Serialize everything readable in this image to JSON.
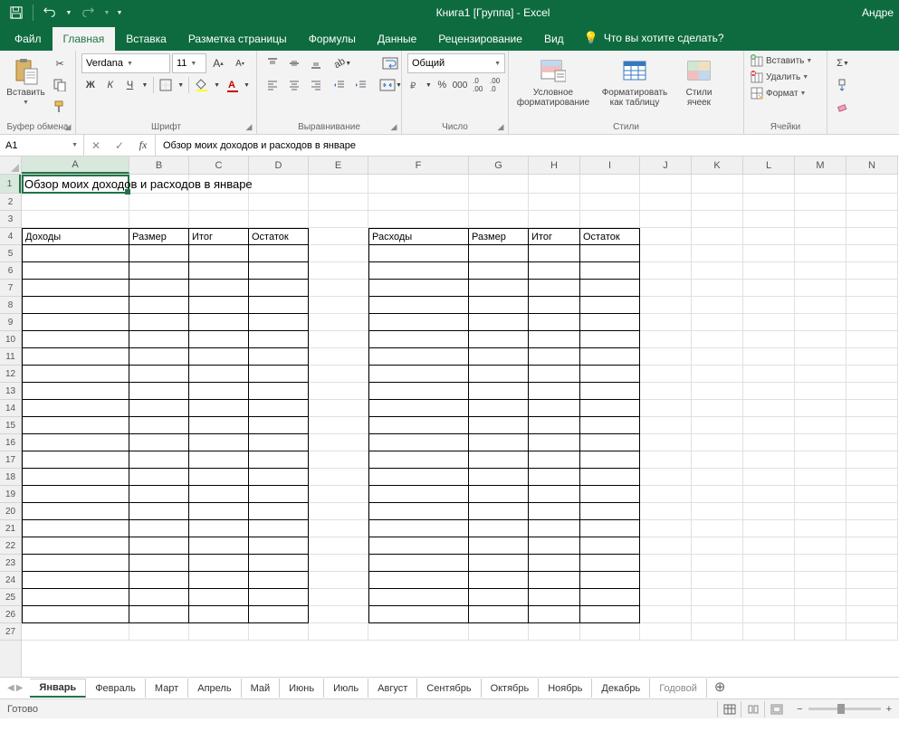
{
  "title": "Книга1  [Группа] - Excel",
  "user": "Андре",
  "menutabs": {
    "file": "Файл",
    "home": "Главная",
    "insert": "Вставка",
    "layout": "Разметка страницы",
    "formulas": "Формулы",
    "data": "Данные",
    "review": "Рецензирование",
    "view": "Вид"
  },
  "tellme": "Что вы хотите сделать?",
  "ribbon": {
    "clipboard": {
      "label": "Буфер обмена",
      "paste": "Вставить"
    },
    "font": {
      "label": "Шрифт",
      "fontname": "Verdana",
      "fontsize": "11"
    },
    "alignment": {
      "label": "Выравнивание"
    },
    "number": {
      "label": "Число",
      "format": "Общий"
    },
    "styles": {
      "label": "Стили",
      "conditional": "Условное форматирование",
      "astable": "Форматировать как таблицу",
      "cellstyles": "Стили ячеек"
    },
    "cells": {
      "label": "Ячейки",
      "insert": "Вставить",
      "delete": "Удалить",
      "format": "Формат"
    }
  },
  "namebox": "A1",
  "formula": "Обзор моих доходов и расходов в январе",
  "columns": [
    "A",
    "B",
    "C",
    "D",
    "E",
    "F",
    "G",
    "H",
    "I",
    "J",
    "K",
    "L",
    "M",
    "N"
  ],
  "rows": [
    "1",
    "2",
    "3",
    "4",
    "5",
    "6",
    "7",
    "8",
    "9",
    "10",
    "11",
    "12",
    "13",
    "14",
    "15",
    "16",
    "17",
    "18",
    "19",
    "20",
    "21",
    "22",
    "23",
    "24",
    "25",
    "26",
    "27"
  ],
  "cell_A1": "Обзор моих доходов и расходов в январе",
  "headers1": {
    "a": "Доходы",
    "b": "Размер",
    "c": "Итог",
    "d": "Остаток"
  },
  "headers2": {
    "f": "Расходы",
    "g": "Размер",
    "h": "Итог",
    "i": "Остаток"
  },
  "sheets": [
    "Январь",
    "Февраль",
    "Март",
    "Апрель",
    "Май",
    "Июнь",
    "Июль",
    "Август",
    "Сентябрь",
    "Октябрь",
    "Ноябрь",
    "Декабрь",
    "Годовой"
  ],
  "status": "Готово"
}
